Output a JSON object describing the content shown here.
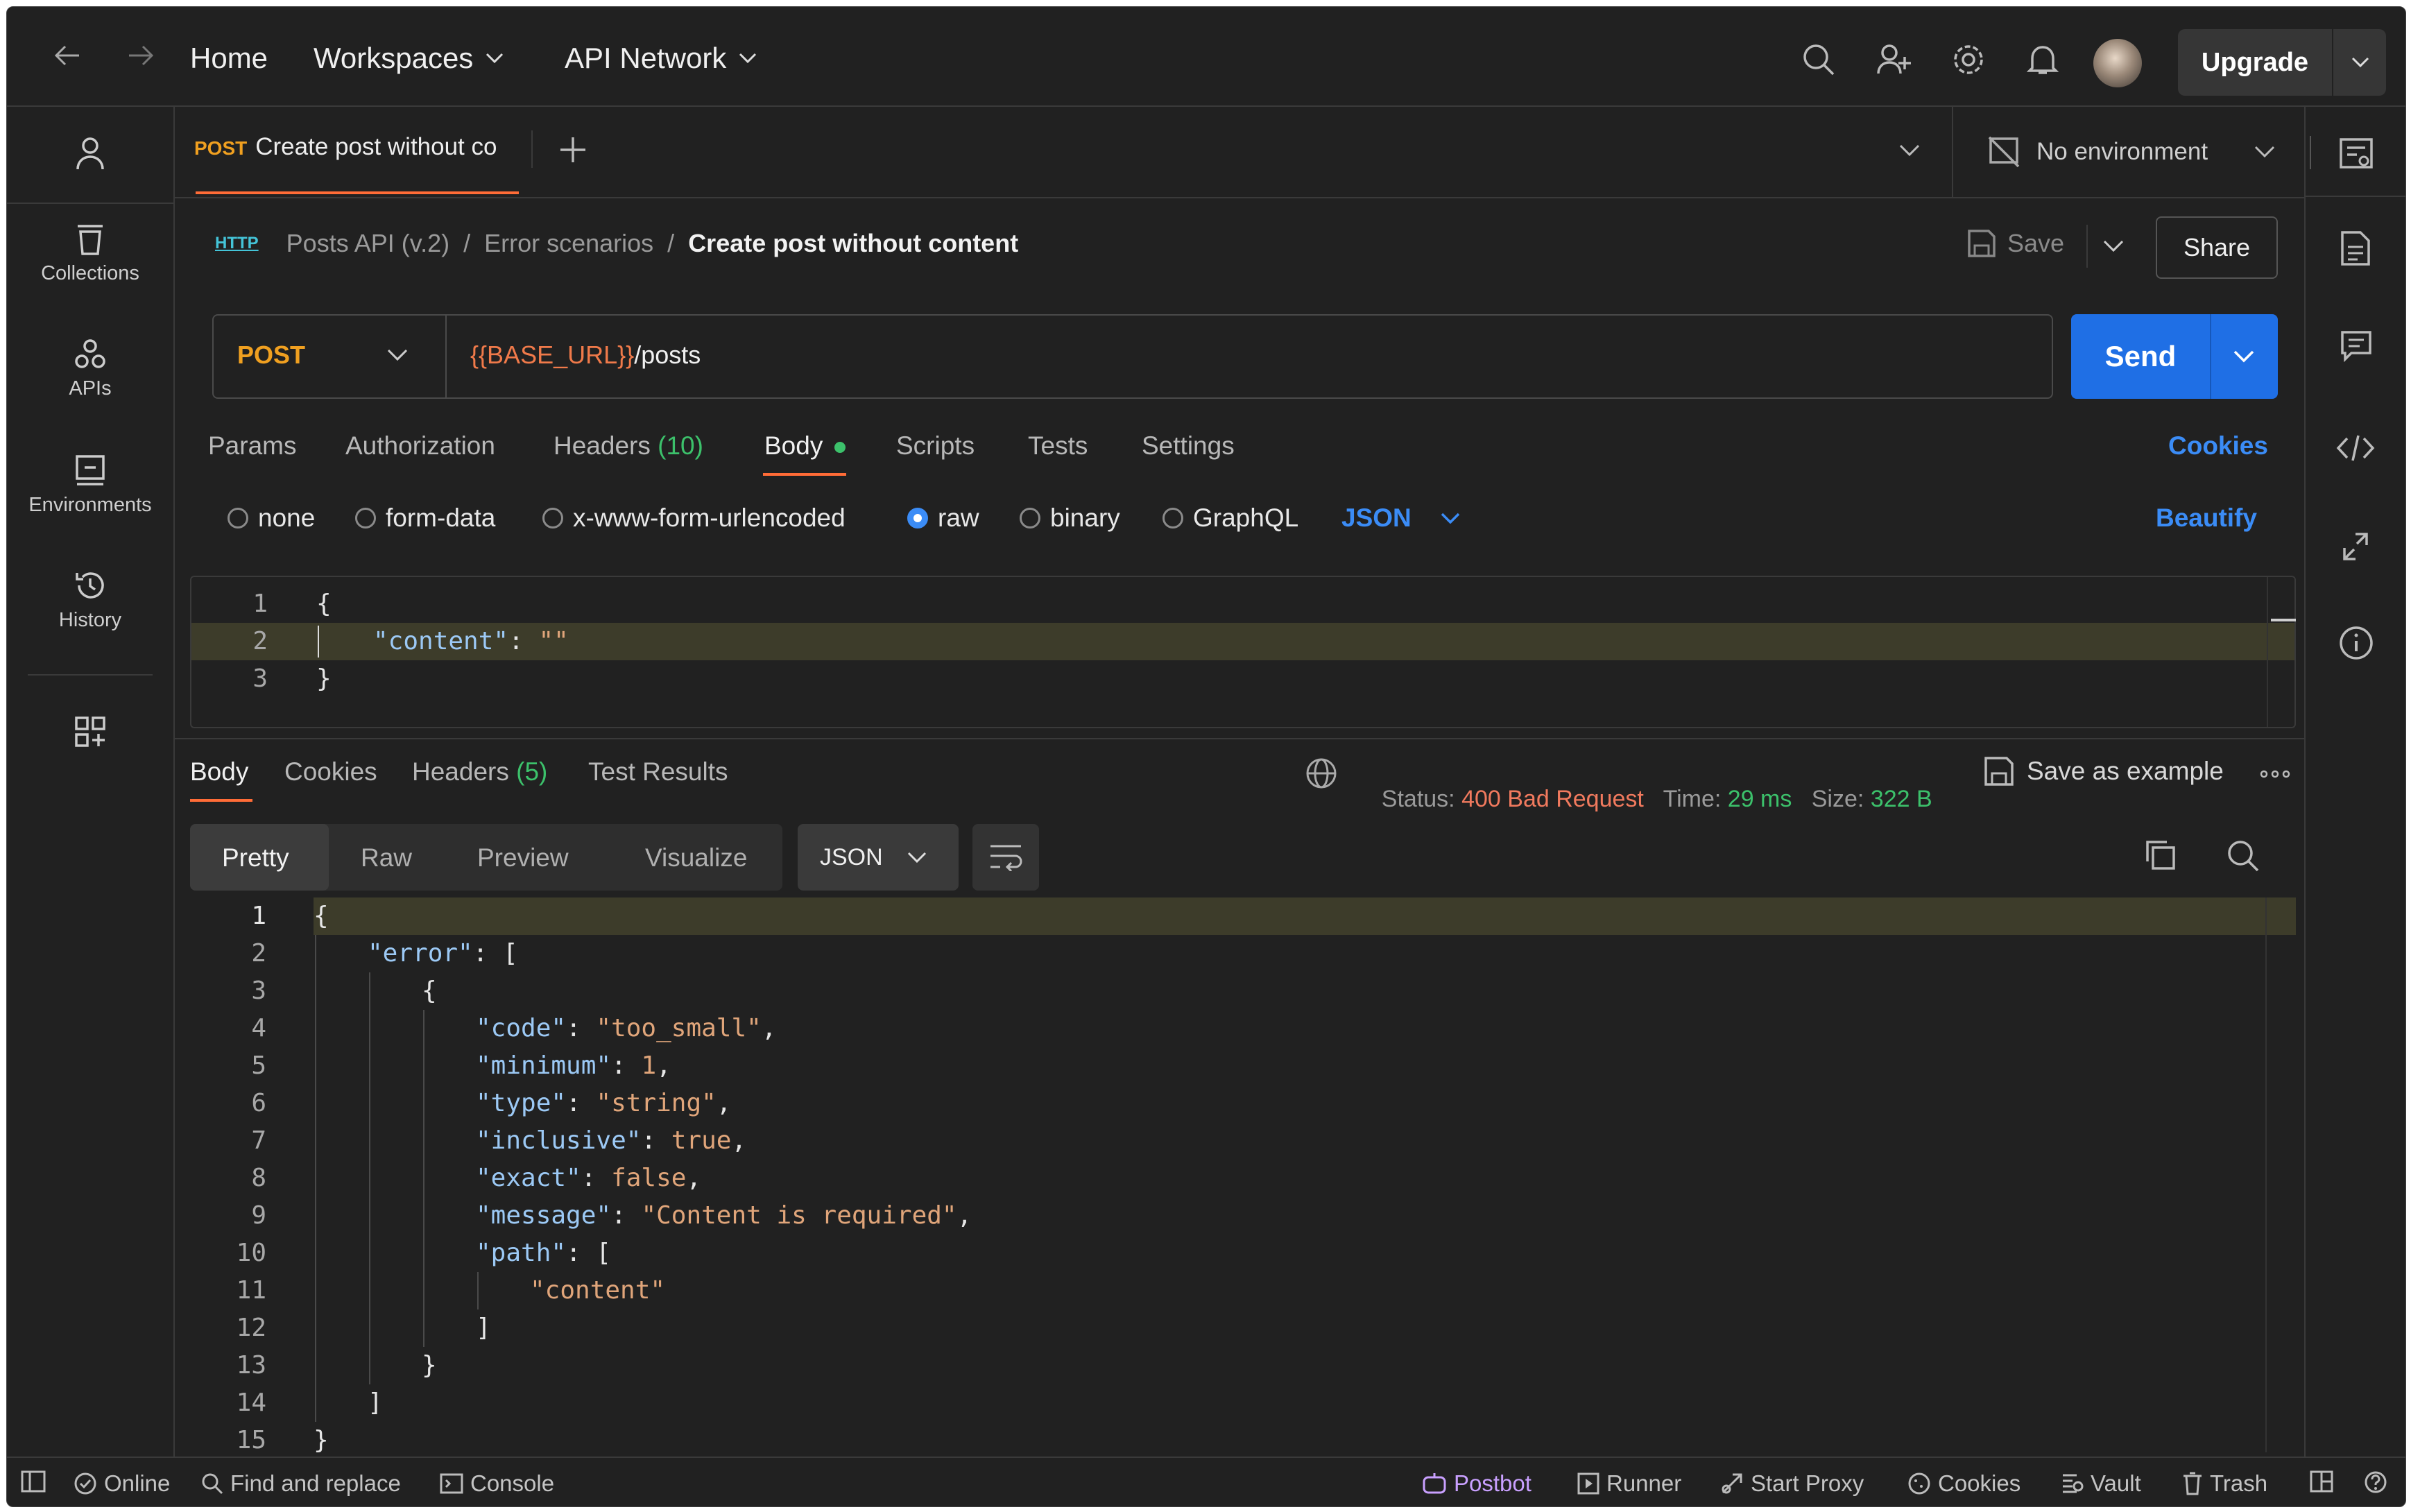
{
  "nav": {
    "home": "Home",
    "workspaces": "Workspaces",
    "api_network": "API Network",
    "upgrade": "Upgrade"
  },
  "sidebar": {
    "items": [
      {
        "label": "Collections"
      },
      {
        "label": "APIs"
      },
      {
        "label": "Environments"
      },
      {
        "label": "History"
      }
    ]
  },
  "tab": {
    "method": "POST",
    "title": "Create post without co"
  },
  "environment": "No environment",
  "breadcrumb": {
    "icon_text": "HTTP",
    "collection": "Posts API (v.2)",
    "sep1": "/",
    "folder": "Error scenarios",
    "sep2": "/",
    "current": "Create post without content"
  },
  "actions": {
    "save": "Save",
    "share": "Share",
    "send": "Send",
    "cookies": "Cookies",
    "beautify": "Beautify"
  },
  "request": {
    "method": "POST",
    "url_var": "{{BASE_URL}}",
    "url_path": "/posts",
    "tabs": [
      "Params",
      "Authorization",
      "Headers",
      "Body",
      "Scripts",
      "Tests",
      "Settings"
    ],
    "headers_count": "(10)",
    "body_options": [
      "none",
      "form-data",
      "x-www-form-urlencoded",
      "raw",
      "binary",
      "GraphQL"
    ],
    "body_format": "JSON",
    "body_lines": [
      {
        "no": "1",
        "text": "{"
      },
      {
        "no": "2",
        "key": "\"content\"",
        "colon": ": ",
        "value": "\"\""
      },
      {
        "no": "3",
        "text": "}"
      }
    ]
  },
  "response": {
    "tabs": [
      "Body",
      "Cookies",
      "Headers",
      "Test Results"
    ],
    "headers_count": "(5)",
    "status_label": "Status:",
    "status_value": "400 Bad Request",
    "time_label": "Time:",
    "time_value": "29 ms",
    "size_label": "Size:",
    "size_value": "322 B",
    "save_example": "Save as example",
    "views": [
      "Pretty",
      "Raw",
      "Preview",
      "Visualize"
    ],
    "format": "JSON",
    "lines": [
      {
        "no": "1",
        "indent": 0,
        "parts": [
          [
            "p",
            "{"
          ]
        ]
      },
      {
        "no": "2",
        "indent": 1,
        "parts": [
          [
            "k",
            "\"error\""
          ],
          [
            "p",
            ": ["
          ]
        ]
      },
      {
        "no": "3",
        "indent": 2,
        "parts": [
          [
            "p",
            "{"
          ]
        ]
      },
      {
        "no": "4",
        "indent": 3,
        "parts": [
          [
            "k",
            "\"code\""
          ],
          [
            "p",
            ": "
          ],
          [
            "s",
            "\"too_small\""
          ],
          [
            "p",
            ","
          ]
        ]
      },
      {
        "no": "5",
        "indent": 3,
        "parts": [
          [
            "k",
            "\"minimum\""
          ],
          [
            "p",
            ": "
          ],
          [
            "n",
            "1"
          ],
          [
            "p",
            ","
          ]
        ]
      },
      {
        "no": "6",
        "indent": 3,
        "parts": [
          [
            "k",
            "\"type\""
          ],
          [
            "p",
            ": "
          ],
          [
            "s",
            "\"string\""
          ],
          [
            "p",
            ","
          ]
        ]
      },
      {
        "no": "7",
        "indent": 3,
        "parts": [
          [
            "k",
            "\"inclusive\""
          ],
          [
            "p",
            ": "
          ],
          [
            "n",
            "true"
          ],
          [
            "p",
            ","
          ]
        ]
      },
      {
        "no": "8",
        "indent": 3,
        "parts": [
          [
            "k",
            "\"exact\""
          ],
          [
            "p",
            ": "
          ],
          [
            "n",
            "false"
          ],
          [
            "p",
            ","
          ]
        ]
      },
      {
        "no": "9",
        "indent": 3,
        "parts": [
          [
            "k",
            "\"message\""
          ],
          [
            "p",
            ": "
          ],
          [
            "s",
            "\"Content is required\""
          ],
          [
            "p",
            ","
          ]
        ]
      },
      {
        "no": "10",
        "indent": 3,
        "parts": [
          [
            "k",
            "\"path\""
          ],
          [
            "p",
            ": ["
          ]
        ]
      },
      {
        "no": "11",
        "indent": 4,
        "parts": [
          [
            "s",
            "\"content\""
          ]
        ]
      },
      {
        "no": "12",
        "indent": 3,
        "parts": [
          [
            "p",
            "]"
          ]
        ]
      },
      {
        "no": "13",
        "indent": 2,
        "parts": [
          [
            "p",
            "}"
          ]
        ]
      },
      {
        "no": "14",
        "indent": 1,
        "parts": [
          [
            "p",
            "]"
          ]
        ]
      },
      {
        "no": "15",
        "indent": 0,
        "parts": [
          [
            "p",
            "}"
          ]
        ]
      }
    ]
  },
  "statusbar": {
    "online": "Online",
    "find_replace": "Find and replace",
    "console": "Console",
    "postbot": "Postbot",
    "runner": "Runner",
    "start_proxy": "Start Proxy",
    "cookies": "Cookies",
    "vault": "Vault",
    "trash": "Trash"
  },
  "colors": {
    "accent_orange": "#ff6c37",
    "send_blue": "#1f6fe5",
    "link_blue": "#3b8cf6",
    "status_red": "#f17a5e",
    "metric_green": "#3cc16b"
  }
}
